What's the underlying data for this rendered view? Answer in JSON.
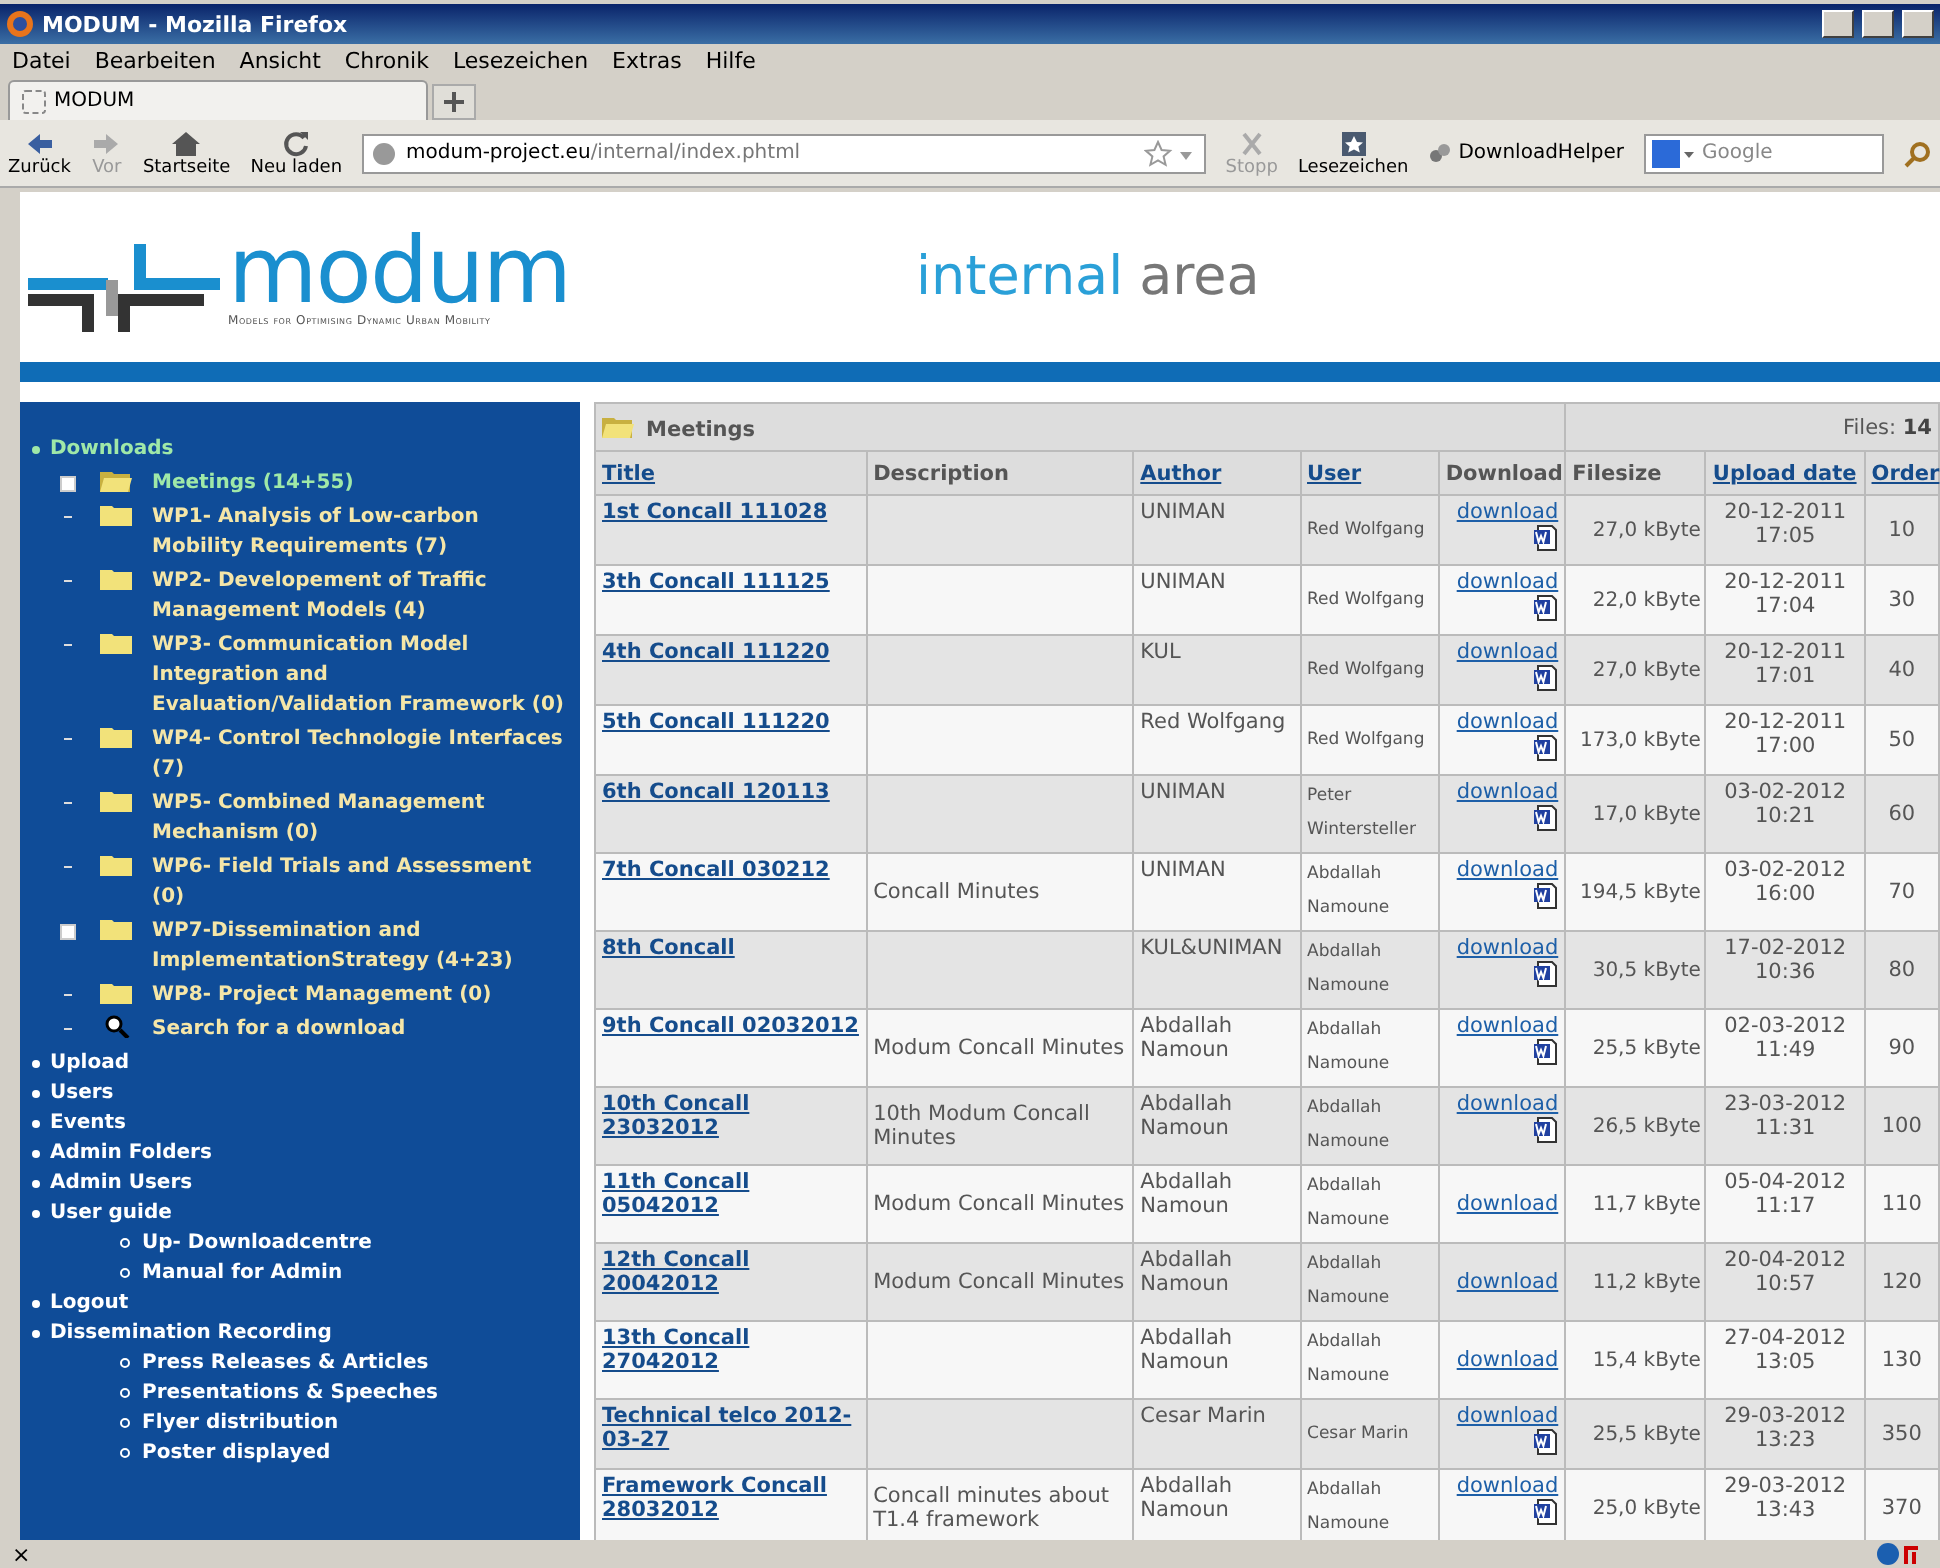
{
  "window": {
    "title": "MODUM - Mozilla Firefox"
  },
  "menu": [
    "Datei",
    "Bearbeiten",
    "Ansicht",
    "Chronik",
    "Lesezeichen",
    "Extras",
    "Hilfe"
  ],
  "tabs": [
    {
      "label": "MODUM",
      "selected": true
    }
  ],
  "toolbar": {
    "buttons": [
      {
        "label": "Zurück",
        "kind": "back",
        "disabled": false
      },
      {
        "label": "Vor",
        "kind": "forward",
        "disabled": true
      },
      {
        "label": "Startseite",
        "kind": "home",
        "disabled": false
      },
      {
        "label": "Neu laden",
        "kind": "reload",
        "disabled": false
      }
    ],
    "url": {
      "host": "modum-project.eu",
      "path": "/internal/index.phtml"
    },
    "right_buttons": [
      {
        "label": "Stopp",
        "kind": "stop",
        "disabled": true
      },
      {
        "label": "Lesezeichen",
        "kind": "bookmarks",
        "disabled": false
      }
    ],
    "addon": "DownloadHelper",
    "search": {
      "placeholder": "Google"
    }
  },
  "header": {
    "logo": "modum",
    "tagline": "Models for Optimising Dynamic Urban Mobility",
    "area_first": "internal",
    "area_second": "area"
  },
  "sidebar": {
    "sections": [
      {
        "items": [
          {
            "label": "Downloads",
            "children": [
              {
                "label": "Meetings (14+55)",
                "expandable": true,
                "kind": "open",
                "selected": true
              },
              {
                "label": "WP1- Analysis of Low-carbon Mobility Requirements (7)",
                "expandable": false,
                "kind": "folder",
                "selected": false
              },
              {
                "label": "WP2- Developement of Traffic Management Models (4)",
                "expandable": false,
                "kind": "folder",
                "selected": false
              },
              {
                "label": "WP3- Communication Model Integration and Evaluation/Validation Framework (0)",
                "expandable": false,
                "kind": "folder",
                "selected": false
              },
              {
                "label": "WP4- Control Technologie Interfaces (7)",
                "expandable": false,
                "kind": "folder",
                "selected": false
              },
              {
                "label": "WP5- Combined Management Mechanism (0)",
                "expandable": false,
                "kind": "folder",
                "selected": false
              },
              {
                "label": "WP6- Field Trials and Assessment (0)",
                "expandable": false,
                "kind": "folder",
                "selected": false
              },
              {
                "label": "WP7-Dissemination and ImplementationStrategy (4+23)",
                "expandable": true,
                "kind": "folder",
                "selected": false
              },
              {
                "label": "WP8- Project Management (0)",
                "expandable": false,
                "kind": "folder",
                "selected": false
              },
              {
                "label": "Search for a download",
                "expandable": false,
                "kind": "search",
                "selected": false
              }
            ]
          },
          {
            "label": "Upload"
          },
          {
            "label": "Users"
          },
          {
            "label": "Events"
          },
          {
            "label": "Admin Folders"
          },
          {
            "label": "Admin Users"
          },
          {
            "label": "User guide",
            "children": [
              {
                "label": "Up- Downloadcentre"
              },
              {
                "label": "Manual for Admin"
              }
            ]
          },
          {
            "label": "Logout"
          }
        ]
      },
      {
        "items": [
          {
            "label": "Dissemination Recording",
            "children": [
              {
                "label": "Press Releases & Articles"
              },
              {
                "label": "Presentations & Speeches"
              },
              {
                "label": "Flyer distribution"
              },
              {
                "label": "Poster displayed"
              }
            ]
          }
        ]
      }
    ]
  },
  "table": {
    "folder": "Meetings",
    "files_label": "Files:",
    "files_count": "14",
    "columns": [
      {
        "label": "Title",
        "sortable": true
      },
      {
        "label": "Description",
        "sortable": false
      },
      {
        "label": "Author",
        "sortable": true
      },
      {
        "label": "User",
        "sortable": true
      },
      {
        "label": "Download",
        "sortable": false
      },
      {
        "label": "Filesize",
        "sortable": false
      },
      {
        "label": "Upload date",
        "sortable": true
      },
      {
        "label": "Order",
        "sortable": true
      }
    ],
    "rows": [
      {
        "title": "1st Concall 111028",
        "description": "",
        "author": "UNIMAN",
        "user": "Red Wolfgang",
        "download": "download",
        "doc_icon": true,
        "filesize": "27,0 kByte",
        "date": "20-12-2011 17:05",
        "order": "10"
      },
      {
        "title": "3th Concall 111125",
        "description": "",
        "author": "UNIMAN",
        "user": "Red Wolfgang",
        "download": "download",
        "doc_icon": true,
        "filesize": "22,0 kByte",
        "date": "20-12-2011 17:04",
        "order": "30"
      },
      {
        "title": "4th Concall 111220",
        "description": "",
        "author": "KUL",
        "user": "Red Wolfgang",
        "download": "download",
        "doc_icon": true,
        "filesize": "27,0 kByte",
        "date": "20-12-2011 17:01",
        "order": "40"
      },
      {
        "title": "5th Concall 111220",
        "description": "",
        "author": "Red Wolfgang",
        "user": "Red Wolfgang",
        "download": "download",
        "doc_icon": true,
        "filesize": "173,0 kByte",
        "date": "20-12-2011 17:00",
        "order": "50"
      },
      {
        "title": "6th Concall 120113",
        "description": "",
        "author": "UNIMAN",
        "user": "Peter Wintersteller",
        "download": "download",
        "doc_icon": true,
        "filesize": "17,0 kByte",
        "date": "03-02-2012 10:21",
        "order": "60"
      },
      {
        "title": "7th Concall 030212",
        "description": "Concall Minutes",
        "author": "UNIMAN",
        "user": "Abdallah Namoune",
        "download": "download",
        "doc_icon": true,
        "filesize": "194,5 kByte",
        "date": "03-02-2012 16:00",
        "order": "70"
      },
      {
        "title": "8th Concall",
        "description": "",
        "author": "KUL&UNIMAN",
        "user": "Abdallah Namoune",
        "download": "download",
        "doc_icon": true,
        "filesize": "30,5 kByte",
        "date": "17-02-2012 10:36",
        "order": "80"
      },
      {
        "title": "9th Concall 02032012",
        "description": "Modum Concall Minutes",
        "author": "Abdallah Namoun",
        "user": "Abdallah Namoune",
        "download": "download",
        "doc_icon": true,
        "filesize": "25,5 kByte",
        "date": "02-03-2012 11:49",
        "order": "90"
      },
      {
        "title": "10th Concall 23032012",
        "description": "10th Modum Concall Minutes",
        "author": "Abdallah Namoun",
        "user": "Abdallah Namoune",
        "download": "download",
        "doc_icon": true,
        "filesize": "26,5 kByte",
        "date": "23-03-2012 11:31",
        "order": "100"
      },
      {
        "title": "11th Concall 05042012",
        "description": "Modum Concall Minutes",
        "author": "Abdallah Namoun",
        "user": "Abdallah Namoune",
        "download": "download",
        "doc_icon": false,
        "filesize": "11,7 kByte",
        "date": "05-04-2012 11:17",
        "order": "110"
      },
      {
        "title": "12th Concall 20042012",
        "description": "Modum Concall Minutes",
        "author": "Abdallah Namoun",
        "user": "Abdallah Namoune",
        "download": "download",
        "doc_icon": false,
        "filesize": "11,2 kByte",
        "date": "20-04-2012 10:57",
        "order": "120"
      },
      {
        "title": "13th Concall 27042012",
        "description": "",
        "author": "Abdallah Namoun",
        "user": "Abdallah Namoune",
        "download": "download",
        "doc_icon": false,
        "filesize": "15,4 kByte",
        "date": "27-04-2012 13:05",
        "order": "130"
      },
      {
        "title": "Technical telco 2012-03-27",
        "description": "",
        "author": "Cesar Marin",
        "user": "Cesar Marin",
        "download": "download",
        "doc_icon": true,
        "filesize": "25,5 kByte",
        "date": "29-03-2012 13:23",
        "order": "350"
      },
      {
        "title": "Framework Concall 28032012",
        "description": "Concall minutes about T1.4 framework",
        "author": "Abdallah Namoun",
        "user": "Abdallah Namoune",
        "download": "download",
        "doc_icon": true,
        "filesize": "25,0 kByte",
        "date": "29-03-2012 13:43",
        "order": "370"
      }
    ]
  },
  "status_bar": {
    "close": "×"
  }
}
